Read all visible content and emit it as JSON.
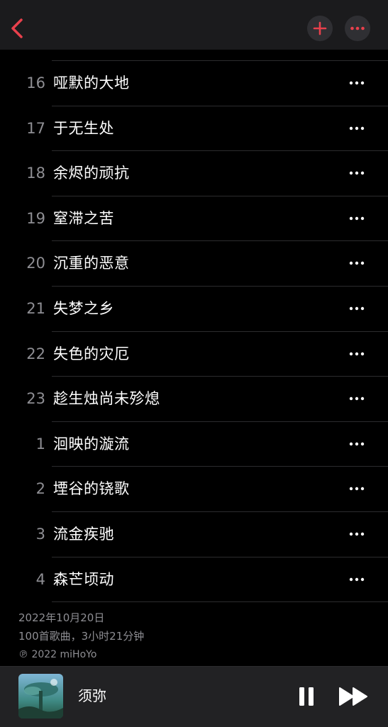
{
  "nav": {
    "back_icon": "chevron-left-icon",
    "add_icon": "plus-icon",
    "more_icon": "ellipsis-icon",
    "accent": "#e8404c"
  },
  "tracks": [
    {
      "num": "16",
      "title": "哑默的大地"
    },
    {
      "num": "17",
      "title": "于无生处"
    },
    {
      "num": "18",
      "title": "余烬的顽抗"
    },
    {
      "num": "19",
      "title": "窒滞之苦"
    },
    {
      "num": "20",
      "title": "沉重的恶意"
    },
    {
      "num": "21",
      "title": "失梦之乡"
    },
    {
      "num": "22",
      "title": "失色的灾厄"
    },
    {
      "num": "23",
      "title": "趁生烛尚未殄熄"
    },
    {
      "num": "1",
      "title": "洄映的漩流"
    },
    {
      "num": "2",
      "title": "堙谷的铙歌"
    },
    {
      "num": "3",
      "title": "流金疾驰"
    },
    {
      "num": "4",
      "title": "森芒顷动"
    }
  ],
  "album_info": {
    "release_date": "2022年10月20日",
    "summary": "100首歌曲，3小时21分钟",
    "copyright": "℗ 2022 miHoYo"
  },
  "now_playing": {
    "title": "须弥",
    "pause_icon": "pause-icon",
    "forward_icon": "fast-forward-icon"
  }
}
